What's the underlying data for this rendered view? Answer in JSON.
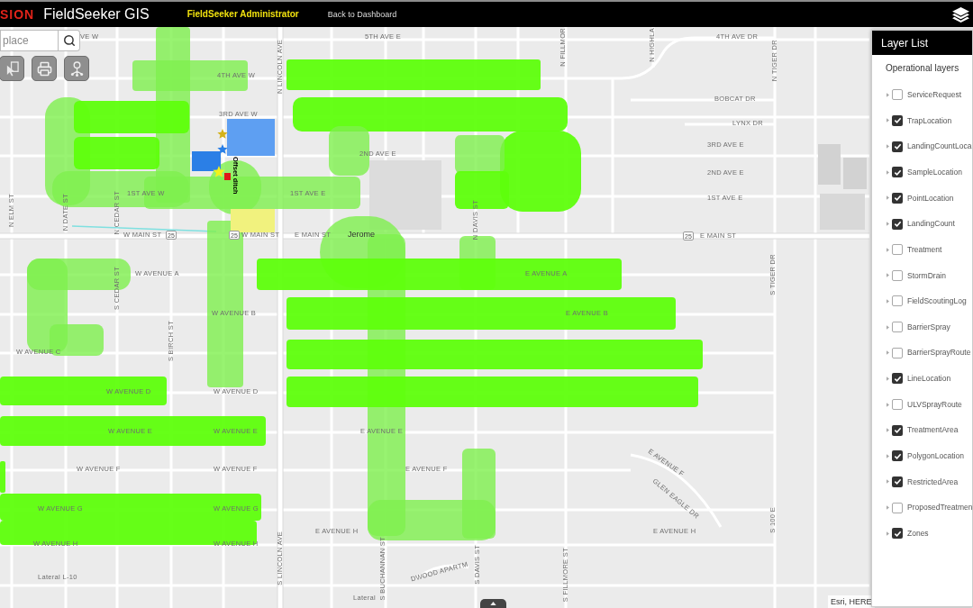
{
  "header": {
    "logo": "SION",
    "title": "FieldSeeker GIS",
    "user": "FieldSeeker Administrator",
    "link": "Back to Dashboard"
  },
  "search": {
    "placeholder": "place"
  },
  "map": {
    "street_labels": [
      "VE W",
      "5TH AVE E",
      "4TH AVE DR",
      "N FILLMOR",
      "N HIGHLA",
      "N LINCOLN AVE",
      "N TIGER DR",
      "4TH AVE W",
      "BOBCAT DR",
      "3RD AVE W",
      "LYNX DR",
      "3RD AVE E",
      "2ND AVE E",
      "2ND AVE E",
      "1ST AVE W",
      "1ST AVE E",
      "1ST AVE E",
      "N ELM ST",
      "N DATE ST",
      "N CEDAR ST",
      "N DAVIS ST",
      "W MAIN ST",
      "W MAIN ST",
      "E MAIN ST",
      "E MAIN ST",
      "S TIGER DR",
      "S CEDAR ST",
      "W AVENUE A",
      "E AVENUE A",
      "W AVENUE B",
      "E AVENUE B",
      "S BIRCH ST",
      "W AVENUE C",
      "W AVENUE D",
      "W AVENUE D",
      "W AVENUE E",
      "W AVENUE E",
      "E AVENUE E",
      "E AVENUE F",
      "W AVENUE F",
      "W AVENUE F",
      "E AVENUE F",
      "GLEN EAGLE DR",
      "W AVENUE G",
      "W AVENUE G",
      "S 100 E",
      "E AVENUE H",
      "E AVENUE H",
      "S LINCOLN AVE",
      "S BUCHANNAN ST",
      "W AVENUE H",
      "W AVENUE H",
      "S DAVIS ST",
      "S FILLMORE ST",
      "DWOOD APARTM",
      "Lateral L-10",
      "Lateral"
    ],
    "route_shields": [
      "25",
      "25",
      "25"
    ],
    "place_labels": [
      "Jerome"
    ],
    "feature_labels": [
      "Offset ditch"
    ],
    "attribution": "Esri, HERE"
  },
  "layer_list": {
    "title": "Layer List",
    "section": "Operational layers",
    "layers": [
      {
        "name": "ServiceRequest",
        "checked": false
      },
      {
        "name": "TrapLocation",
        "checked": true
      },
      {
        "name": "LandingCountLoca",
        "checked": true
      },
      {
        "name": "SampleLocation",
        "checked": true
      },
      {
        "name": "PointLocation",
        "checked": true
      },
      {
        "name": "LandingCount",
        "checked": true
      },
      {
        "name": "Treatment",
        "checked": false
      },
      {
        "name": "StormDrain",
        "checked": false
      },
      {
        "name": "FieldScoutingLog",
        "checked": false
      },
      {
        "name": "BarrierSpray",
        "checked": false
      },
      {
        "name": "BarrierSprayRoute",
        "checked": false
      },
      {
        "name": "LineLocation",
        "checked": true
      },
      {
        "name": "ULVSprayRoute",
        "checked": false
      },
      {
        "name": "TreatmentArea",
        "checked": true
      },
      {
        "name": "PolygonLocation",
        "checked": true
      },
      {
        "name": "RestrictedArea",
        "checked": true
      },
      {
        "name": "ProposedTreatmen",
        "checked": false
      },
      {
        "name": "Zones",
        "checked": true
      }
    ]
  }
}
